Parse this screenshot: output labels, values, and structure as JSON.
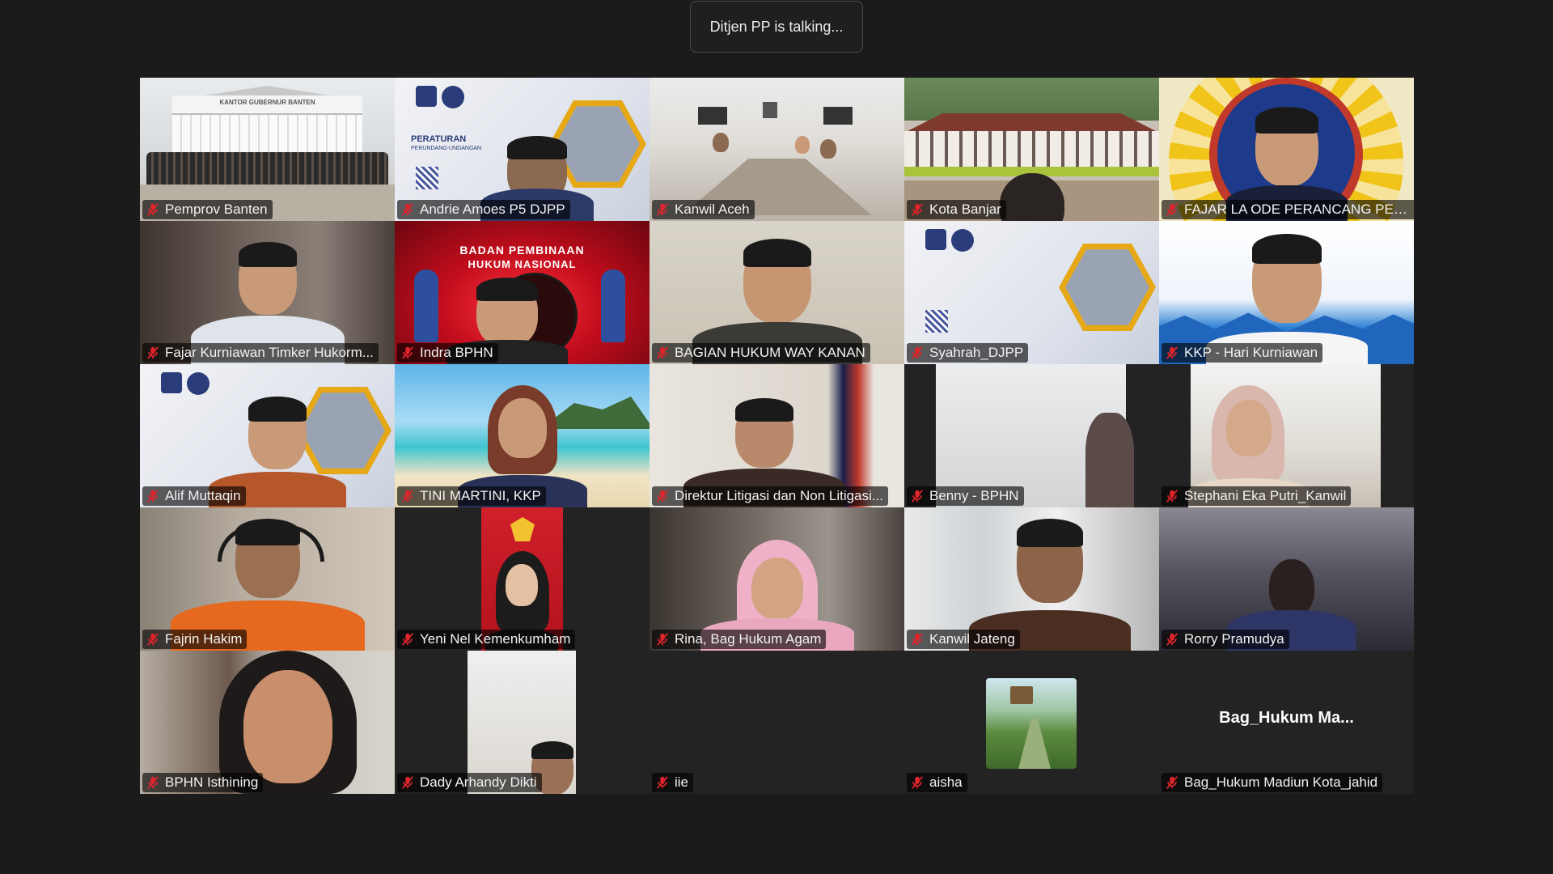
{
  "banner": {
    "text": "Ditjen PP is talking..."
  },
  "icons": {
    "mic": "mic-muted-icon",
    "mic_color": "#e0242b"
  },
  "tiles": [
    {
      "name": "Pemprov Banten"
    },
    {
      "name": "Andrie Amoes P5 DJPP"
    },
    {
      "name": "Kanwil Aceh"
    },
    {
      "name": "Kota Banjar"
    },
    {
      "name": "FAJAR LA ODE PERANCANG PER..."
    },
    {
      "name": "Fajar Kurniawan Timker Hukorm..."
    },
    {
      "name": "Indra BPHN"
    },
    {
      "name": "BAGIAN HUKUM WAY KANAN"
    },
    {
      "name": "Syahrah_DJPP"
    },
    {
      "name": "KKP - Hari Kurniawan"
    },
    {
      "name": "Alif Muttaqin"
    },
    {
      "name": "TINI MARTINI, KKP"
    },
    {
      "name": "Direktur Litigasi dan Non Litigasi..."
    },
    {
      "name": "Benny - BPHN"
    },
    {
      "name": "Stephani Eka Putri_Kanwil"
    },
    {
      "name": "Fajrin Hakim"
    },
    {
      "name": "Yeni Nel Kemenkumham"
    },
    {
      "name": "Rina, Bag Hukum Agam"
    },
    {
      "name": "Kanwil Jateng"
    },
    {
      "name": "Rorry Pramudya"
    },
    {
      "name": "BPHN Isthining"
    },
    {
      "name": "Dady Arhandy Dikti"
    },
    {
      "name": "iie"
    },
    {
      "name": "aisha"
    },
    {
      "name": "Bag_Hukum Madiun Kota_jahid",
      "placeholder": "Bag_Hukum  Ma..."
    }
  ],
  "backgrounds": {
    "banner_text": "KANTOR GUBERNUR BANTEN",
    "djpp_text": "PERATURAN",
    "djpp_sub": "PERUNDANG-UNDANGAN",
    "bphn_title_1": "BADAN PEMBINAAN",
    "bphn_title_2": "HUKUM NASIONAL"
  }
}
